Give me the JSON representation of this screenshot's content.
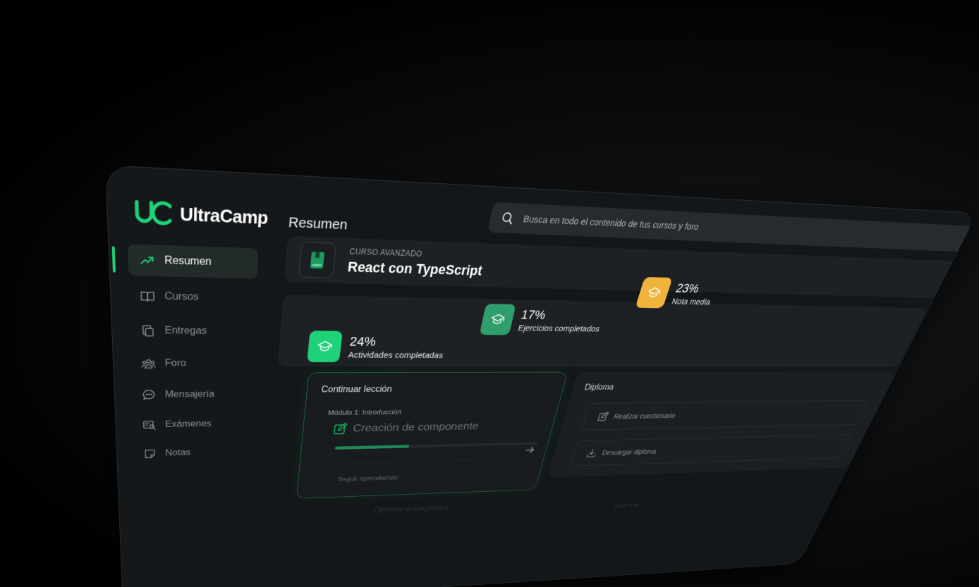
{
  "app": {
    "brand": "UltraCamp",
    "accent": "#1ed27a"
  },
  "search": {
    "placeholder": "Busca en todo el contenido de tus cursos y foro"
  },
  "sidebar": {
    "items": [
      {
        "label": "Resumen",
        "icon": "trending-up-icon",
        "active": true
      },
      {
        "label": "Cursos",
        "icon": "book-open-icon"
      },
      {
        "label": "Entregas",
        "icon": "copy-icon"
      },
      {
        "label": "Foro",
        "icon": "users-icon"
      },
      {
        "label": "Mensajería",
        "icon": "chat-bubble-icon"
      },
      {
        "label": "Exámenes",
        "icon": "exam-search-icon"
      },
      {
        "label": "Notas",
        "icon": "sticky-note-icon"
      }
    ]
  },
  "main": {
    "title": "Resumen",
    "course": {
      "kicker": "CURSO AVANZADO",
      "name": "React con TypeScript",
      "icon": "bookmark-book-icon"
    },
    "stats": [
      {
        "value": "24%",
        "label": "Actividades completadas",
        "color": "#1ed27a",
        "icon": "graduation-cap-icon"
      },
      {
        "value": "17%",
        "label": "Ejercicios completados",
        "color": "#2f9e6d",
        "icon": "graduation-cap-icon"
      },
      {
        "value": "23%",
        "label": "Nota media",
        "color": "#f0b43c",
        "icon": "graduation-cap-icon"
      }
    ],
    "lesson": {
      "title": "Continuar lección",
      "module": "Módulo 1: Introducción",
      "name": "Creación de componente",
      "progress": 0.35,
      "cta": "Seguir aprendiendo"
    },
    "diploma": {
      "title": "Diploma",
      "actions": [
        {
          "label": "Realizar cuestionario",
          "icon": "edit-icon"
        },
        {
          "label": "Descargar diploma",
          "icon": "download-icon"
        }
      ]
    },
    "deliverables": {
      "title": "Últimos entregables",
      "column": "Nota final"
    }
  }
}
